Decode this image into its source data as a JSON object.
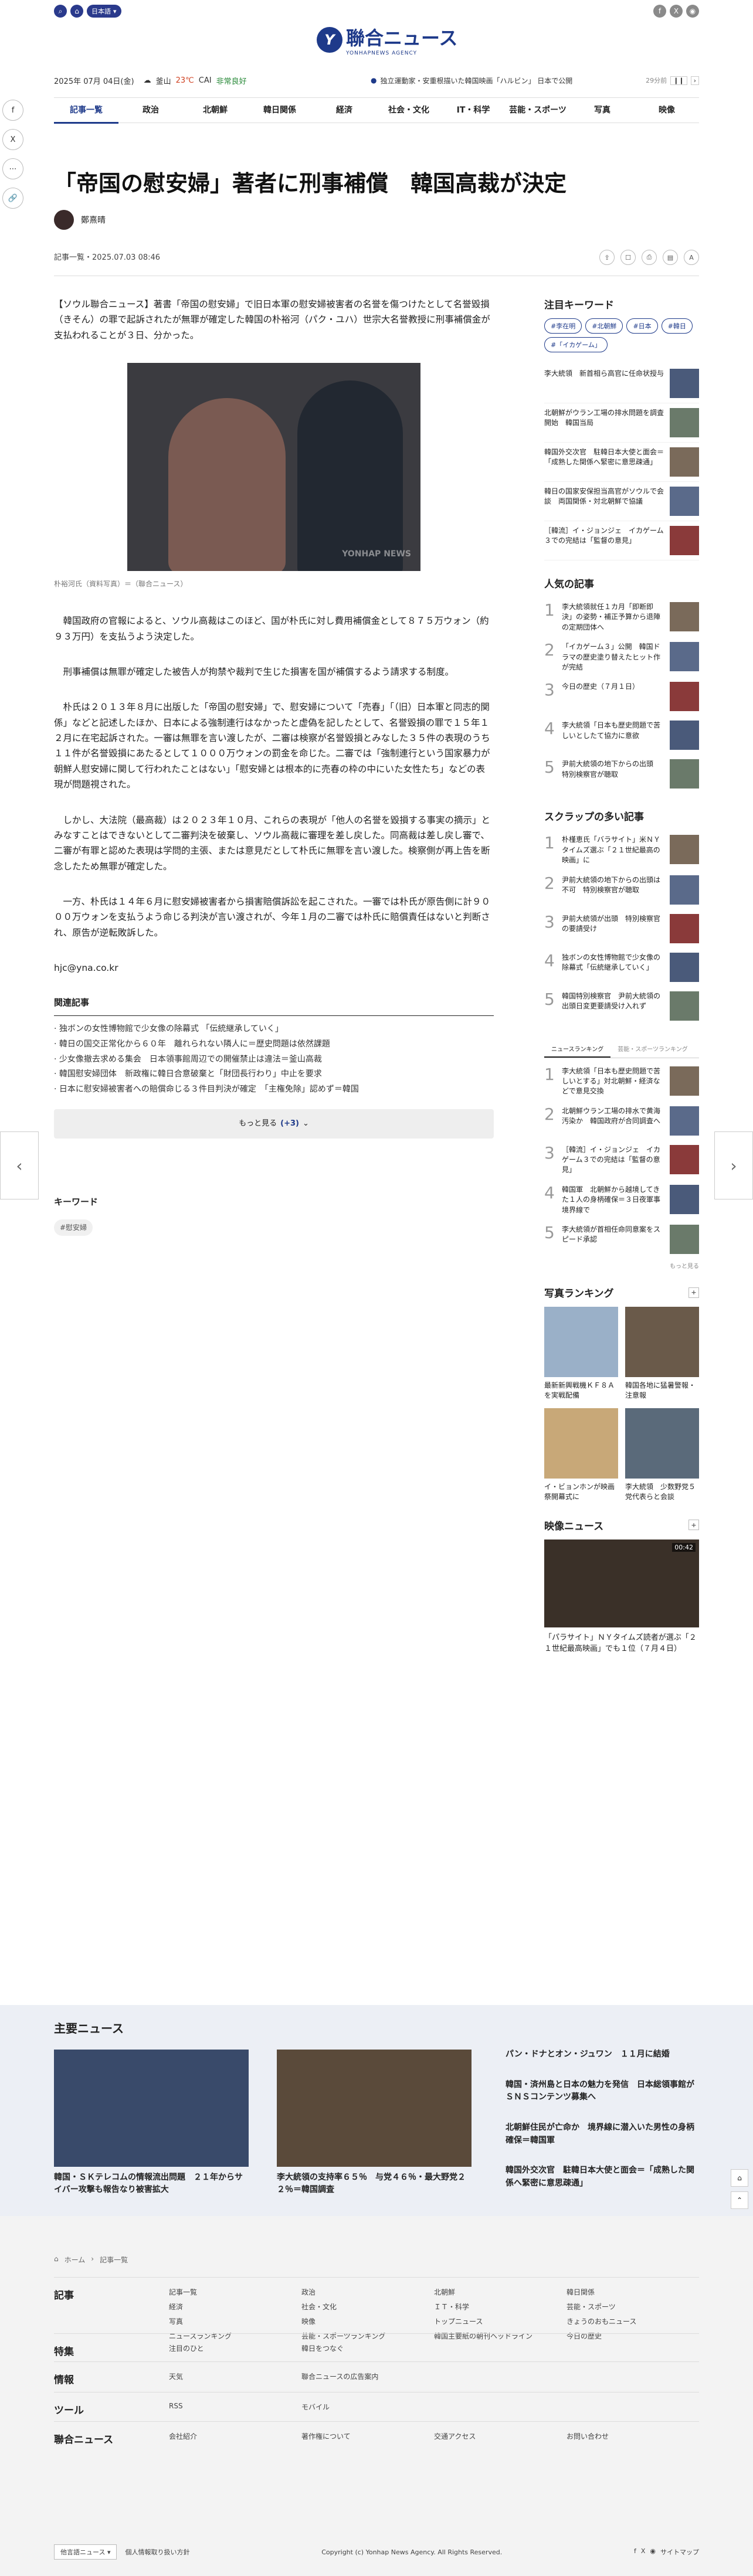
{
  "header": {
    "lang": "日本語",
    "logo_name": "聯合ニュース",
    "logo_sub": "YONHAPNEWS AGENCY"
  },
  "infobar": {
    "date": "2025年 07月 04日(金)",
    "city": "釜山",
    "temp": "23℃",
    "cai": "CAI",
    "cai_status": "非常良好",
    "ticker": "独立運動家・安重根描いた韓国映画「ハルビン」 日本で公開",
    "ticker_time": "29分前"
  },
  "nav": [
    "記事一覧",
    "政治",
    "北朝鮮",
    "韓日関係",
    "経済",
    "社会・文化",
    "IT・科学",
    "芸能・スポーツ",
    "写真",
    "映像"
  ],
  "article": {
    "title": "「帝国の慰安婦」著者に刑事補償　韓国高裁が決定",
    "author": "鄭熹晴",
    "meta": "記事一覧・2025.07.03 08:46",
    "paragraphs": [
      "【ソウル聯合ニュース】著書「帝国の慰安婦」で旧日本軍の慰安婦被害者の名誉を傷つけたとして名誉毀損（きそん）の罪で起訴されたが無罪が確定した韓国の朴裕河（パク・ユハ）世宗大名誉教授に刑事補償金が支払われることが３日、分かった。"
    ],
    "caption": "朴裕河氏（資料写真）＝（聯合ニュース）",
    "paragraphs2": [
      "　韓国政府の官報によると、ソウル高裁はこのほど、国が朴氏に対し費用補償金として８７５万ウォン（約９３万円）を支払うよう決定した。",
      "　刑事補償は無罪が確定した被告人が拘禁や裁判で生じた損害を国が補償するよう請求する制度。",
      "　朴氏は２０１３年８月に出版した「帝国の慰安婦」で、慰安婦について「売春」「（旧）日本軍と同志的関係」などと記述したほか、日本による強制連行はなかったと虚偽を記したとして、名誉毀損の罪で１５年１２月に在宅起訴された。一審は無罪を言い渡したが、二審は検察が名誉毀損とみなした３５件の表現のうち１１件が名誉毀損にあたるとして１０００万ウォンの罰金を命じた。二審では「強制連行という国家暴力が朝鮮人慰安婦に関して行われたことはない」「慰安婦とは根本的に売春の枠の中にいた女性たち」などの表現が問題視された。",
      "　しかし、大法院（最高裁）は２０２３年１０月、これらの表現が「他人の名誉を毀損する事実の摘示」とみなすことはできないとして二審判決を破棄し、ソウル高裁に審理を差し戻した。同高裁は差し戻し審で、二審が有罪と認めた表現は学問的主張、または意見だとして朴氏に無罪を言い渡した。検察側が再上告を断念したため無罪が確定した。",
      "　一方、朴氏は１４年６月に慰安婦被害者から損害賠償訴訟を起こされた。一審では朴氏が原告側に計９０００万ウォンを支払うよう命じる判決が言い渡されが、今年１月の二審では朴氏に賠償責任はないと判断され、原告が逆転敗訴した。"
    ],
    "email": "hjc@yna.co.kr",
    "related_title": "関連記事",
    "related": [
      "独ボンの女性博物館で少女像の除幕式 「伝統継承していく」",
      "韓日の国交正常化から６０年　離れられない隣人に＝歴史問題は依然課題",
      "少女像撤去求める集会　日本領事館周辺での開催禁止は違法＝釜山高裁",
      "韓国慰安婦団体　新政権に韓日合意破棄と「財団長行わり」中止を要求",
      "日本に慰安婦被害者への賠償命じる３件目判決が確定　「主権免除」認めず＝韓国"
    ],
    "more": "もっと見る",
    "more_count": "(+3)",
    "keywords_title": "キーワード",
    "keyword": "#慰安婦"
  },
  "rail": {
    "kw_title": "注目キーワード",
    "chips": [
      "#李在明",
      "#北朝鮮",
      "#日本",
      "#韓日",
      "#「イカゲーム」"
    ],
    "news": [
      "李大統領　新首相ら高官に任命状授与",
      "北朝鮮がウラン工場の排水問題を調査開始　韓国当局",
      "韓国外交次官　駐韓日本大使と面会＝「成熟した関係へ緊密に意思疎通」",
      "韓日の国家安保担当高官がソウルで会談　両国関係・対北朝鮮で協議",
      "［韓流］イ・ジョンジェ　イカゲーム３での完結は「監督の意見」"
    ],
    "pop_title": "人気の記事",
    "pop": [
      "李大統領就任１カ月「即断即決」の姿勢・補正予算から退陣の定期団体へ",
      "「イカゲーム３」公開　韓国ドラマの歴史塗り替えたヒット作が完結",
      "今日の歴史（７月１日）",
      "李大統領「日本も歴史問題で苦しいとしたて協力に意欲",
      "尹前大統領の地下からの出頭　特別検察官が聴取"
    ],
    "scrap_title": "スクラップの多い記事",
    "scrap": [
      "朴槿恵氏「バラサイト」米ＮＹタイムズ選ぶ「２１世紀最高の映画」に",
      "尹前大統領の地下からの出頭は不可　特別検察官が聴取",
      "尹前大統領が出頭　特別検察官の要請受け",
      "独ボンの女性博物館で少女像の除幕式「伝統継承していく」",
      "韓国特別検察官　尹前大統領の出頭日変更要請受け入れず"
    ],
    "tabs": [
      "ニュースランキング",
      "芸能・スポーツランキング"
    ],
    "rank": [
      "李大統領「日本も歴史問題で苦しいとする」対北朝鮮・経済などで意見交換",
      "北朝鮮ウラン工場の排水で黄海汚染か　韓国政府が合同調査へ",
      "［韓流］イ・ジョンジェ　イカゲーム３での完結は「監督の意見」",
      "韓国軍　北朝鮮から越境してきた１人の身柄確保＝３日夜軍事境界線で",
      "李大統領が首相任命同意案をスピード承認"
    ],
    "more": "もっと見る",
    "photo_title": "写真ランキング",
    "photos": [
      "最新新興戦機ＫＦ８Ａを実戦配備",
      "韓国各地に猛暑警報・注意報",
      "イ・ビョンホンが映画祭開幕式に",
      "李大統領　少数野党５党代表らと会談"
    ],
    "video_title": "映像ニュース",
    "video_time": "00:42",
    "video_cap": "「パラサイト」ＮＹタイムズ読者が選ぶ「２１世紀最高映画」でも１位（７月４日）"
  },
  "band": {
    "title": "主要ニュース",
    "cards": [
      "韓国・ＳＫテレコムの情報流出問題　２１年からサイバー攻撃も報告なり被害拡大",
      "李大統領の支持率６５％　与党４６％・最大野党２２％＝韓国調査"
    ],
    "list": [
      "パン・ドナとオン・ジュワン　１１月に結婚",
      "韓国・済州島と日本の魅力を発信　日本総領事館がＳＮＳコンテンツ募集へ",
      "北朝鮮住民が亡命か　境界線に潜入いた男性の身柄確保＝韓国軍",
      "韓国外交次官　駐韓日本大使と面会＝「成熟した関係へ緊密に意思疎通」"
    ]
  },
  "footer": {
    "crumbs": [
      "ホーム",
      "記事一覧"
    ],
    "rows": [
      {
        "h": "記事",
        "items": [
          "記事一覧",
          "政治",
          "北朝鮮",
          "韓日関係",
          "経済",
          "社会・文化",
          "ＩＴ・科学",
          "芸能・スポーツ",
          "写真",
          "映像",
          "トップニュース",
          "きょうのおもニュース",
          "ニュースランキング",
          "芸能・スポーツランキング",
          "韓国主要紙の朝刊ヘッドライン",
          "今日の歴史"
        ]
      },
      {
        "h": "特集",
        "items": [
          "注目のひと",
          "韓日をつなぐ"
        ]
      },
      {
        "h": "情報",
        "items": [
          "天気",
          "聯合ニュースの広告案内"
        ]
      },
      {
        "h": "ツール",
        "items": [
          "RSS",
          "モバイル"
        ]
      },
      {
        "h": "聯合ニュース",
        "items": [
          "会社紹介",
          "著作権について",
          "交通アクセス",
          "お問い合わせ"
        ]
      }
    ],
    "select": "他言語ニュース",
    "privacy": "個人情報取り扱い方針",
    "copy": "Copyright (c) Yonhap News Agency. All Rights Reserved.",
    "sitemap": "サイトマップ"
  }
}
